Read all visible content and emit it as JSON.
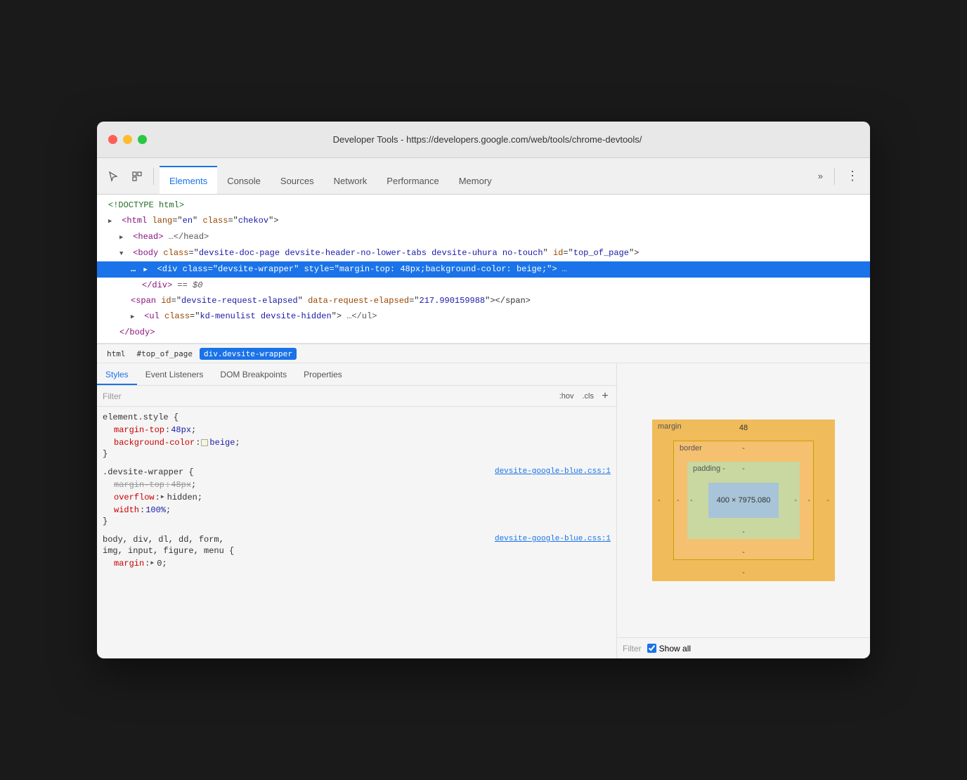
{
  "window": {
    "title": "Developer Tools - https://developers.google.com/web/tools/chrome-devtools/"
  },
  "toolbar": {
    "tabs": [
      {
        "id": "elements",
        "label": "Elements",
        "active": true
      },
      {
        "id": "console",
        "label": "Console",
        "active": false
      },
      {
        "id": "sources",
        "label": "Sources",
        "active": false
      },
      {
        "id": "network",
        "label": "Network",
        "active": false
      },
      {
        "id": "performance",
        "label": "Performance",
        "active": false
      },
      {
        "id": "memory",
        "label": "Memory",
        "active": false
      }
    ],
    "more_label": "»",
    "menu_label": "⋮"
  },
  "dom_tree": {
    "lines": [
      {
        "id": "doctype",
        "text": "<!DOCTYPE html>",
        "indent": 0,
        "selected": false
      },
      {
        "id": "html",
        "text_parts": [
          {
            "type": "tag",
            "t": "<html"
          },
          {
            "type": "space",
            "t": " "
          },
          {
            "type": "attr-name",
            "t": "lang"
          },
          {
            "type": "equals",
            "t": "="
          },
          {
            "type": "attr-value",
            "t": "\"en\""
          },
          {
            "type": "space",
            "t": " "
          },
          {
            "type": "attr-name",
            "t": "class"
          },
          {
            "type": "equals",
            "t": "="
          },
          {
            "type": "attr-value",
            "t": "\"chekov\""
          },
          {
            "type": "tag",
            "t": ">"
          }
        ],
        "indent": 0,
        "selected": false
      },
      {
        "id": "head",
        "text_parts": [
          {
            "type": "triangle",
            "t": "▶"
          },
          {
            "type": "tag",
            "t": "<head>"
          },
          {
            "type": "ellipsis",
            "t": "…</head>"
          }
        ],
        "indent": 1,
        "selected": false
      },
      {
        "id": "body",
        "text_parts": [
          {
            "type": "triangle",
            "t": "▼"
          },
          {
            "type": "tag",
            "t": "<body"
          },
          {
            "type": "space",
            "t": " "
          },
          {
            "type": "attr-name",
            "t": "class"
          },
          {
            "type": "equals",
            "t": "="
          },
          {
            "type": "attr-value",
            "t": "\"devsite-doc-page devsite-header-no-lower-tabs devsite-uhura no-touch\""
          },
          {
            "type": "space",
            "t": " "
          },
          {
            "type": "attr-name",
            "t": "id"
          },
          {
            "type": "equals",
            "t": "="
          },
          {
            "type": "attr-value",
            "t": "\"top_of_page\""
          },
          {
            "type": "tag",
            "t": ">"
          }
        ],
        "indent": 1,
        "selected": false,
        "multiline": true
      },
      {
        "id": "div-wrapper",
        "text_parts": [
          {
            "type": "dots",
            "t": "…"
          },
          {
            "type": "space",
            "t": " "
          },
          {
            "type": "triangle",
            "t": "▶"
          },
          {
            "type": "tag",
            "t": "<div"
          },
          {
            "type": "space",
            "t": " "
          },
          {
            "type": "attr-name",
            "t": "class"
          },
          {
            "type": "equals",
            "t": "="
          },
          {
            "type": "attr-value",
            "t": "\"devsite-wrapper\""
          },
          {
            "type": "space",
            "t": " "
          },
          {
            "type": "attr-name",
            "t": "style"
          },
          {
            "type": "equals",
            "t": "="
          },
          {
            "type": "attr-value",
            "t": "\"margin-top: 48px;background-color: beige;\""
          },
          {
            "type": "tag",
            "t": ">"
          },
          {
            "type": "ellipsis",
            "t": "…"
          },
          {
            "type": "dollar-zero",
            "t": " == $0"
          }
        ],
        "indent": 2,
        "selected": true
      },
      {
        "id": "div-close",
        "text_parts": [
          {
            "type": "tag",
            "t": "</div>"
          },
          {
            "type": "dollar-zero",
            "t": " == $0"
          }
        ],
        "indent": 3,
        "selected": false
      },
      {
        "id": "span",
        "text_parts": [
          {
            "type": "tag",
            "t": "<span"
          },
          {
            "type": "space",
            "t": " "
          },
          {
            "type": "attr-name",
            "t": "id"
          },
          {
            "type": "equals",
            "t": "="
          },
          {
            "type": "attr-value",
            "t": "\"devsite-request-elapsed\""
          },
          {
            "type": "space",
            "t": " "
          },
          {
            "type": "attr-name",
            "t": "data-request-elapsed"
          },
          {
            "type": "equals",
            "t": "="
          },
          {
            "type": "attr-value",
            "t": "\"217.990159988\""
          },
          {
            "type": "tag",
            "t": "></span>"
          }
        ],
        "indent": 2,
        "selected": false
      },
      {
        "id": "ul",
        "text_parts": [
          {
            "type": "triangle",
            "t": "▶"
          },
          {
            "type": "tag",
            "t": "<ul"
          },
          {
            "type": "space",
            "t": " "
          },
          {
            "type": "attr-name",
            "t": "class"
          },
          {
            "type": "equals",
            "t": "="
          },
          {
            "type": "attr-value",
            "t": "\"kd-menulist devsite-hidden\""
          },
          {
            "type": "tag",
            "t": ">"
          },
          {
            "type": "ellipsis",
            "t": "…</ul>"
          }
        ],
        "indent": 2,
        "selected": false
      },
      {
        "id": "body-close",
        "text_parts": [
          {
            "type": "tag",
            "t": "</body>"
          }
        ],
        "indent": 1,
        "selected": false
      }
    ]
  },
  "breadcrumb": {
    "items": [
      {
        "id": "html-bc",
        "label": "html",
        "active": false
      },
      {
        "id": "top-bc",
        "label": "#top_of_page",
        "active": false
      },
      {
        "id": "div-bc",
        "label": "div.devsite-wrapper",
        "active": true
      }
    ]
  },
  "lower_panel": {
    "tabs": [
      {
        "id": "styles",
        "label": "Styles",
        "active": true
      },
      {
        "id": "event-listeners",
        "label": "Event Listeners",
        "active": false
      },
      {
        "id": "dom-breakpoints",
        "label": "DOM Breakpoints",
        "active": false
      },
      {
        "id": "properties",
        "label": "Properties",
        "active": false
      }
    ],
    "filter": {
      "placeholder": "Filter",
      "hov_label": ":hov",
      "cls_label": ".cls",
      "plus_label": "+"
    },
    "css_rules": [
      {
        "id": "element-style",
        "selector": "element.style {",
        "source": "",
        "props": [
          {
            "name": "margin-top",
            "value": "48px",
            "strikethrough": false,
            "color": null
          },
          {
            "name": "background-color",
            "value": "beige",
            "strikethrough": false,
            "color": "beige"
          }
        ],
        "close": "}"
      },
      {
        "id": "devsite-wrapper",
        "selector": ".devsite-wrapper {",
        "source": "devsite-google-blue.css:1",
        "props": [
          {
            "name": "margin-top",
            "value": "48px",
            "strikethrough": true,
            "color": null
          },
          {
            "name": "overflow",
            "value": "hidden",
            "strikethrough": false,
            "color": null,
            "has_arrow": true
          },
          {
            "name": "width",
            "value": "100%",
            "strikethrough": false,
            "color": null
          }
        ],
        "close": "}"
      },
      {
        "id": "body-div-etc",
        "selector": "body, div, dl, dd, form,",
        "selector2": "img, input, figure, menu {",
        "source": "devsite-google-blue.css:1",
        "props": [
          {
            "name": "margin",
            "value": "0",
            "strikethrough": false,
            "color": null,
            "has_arrow": true
          }
        ]
      }
    ]
  },
  "box_model": {
    "margin_label": "margin",
    "margin_top": "48",
    "margin_right": "-",
    "margin_bottom": "-",
    "margin_left": "-",
    "border_label": "border",
    "border_top": "-",
    "padding_label": "padding -",
    "padding_top": "-",
    "content_size": "400 × 7975.080",
    "content_dash": "-"
  },
  "filter_bottom": {
    "label": "Filter",
    "show_all_label": "Show all"
  }
}
